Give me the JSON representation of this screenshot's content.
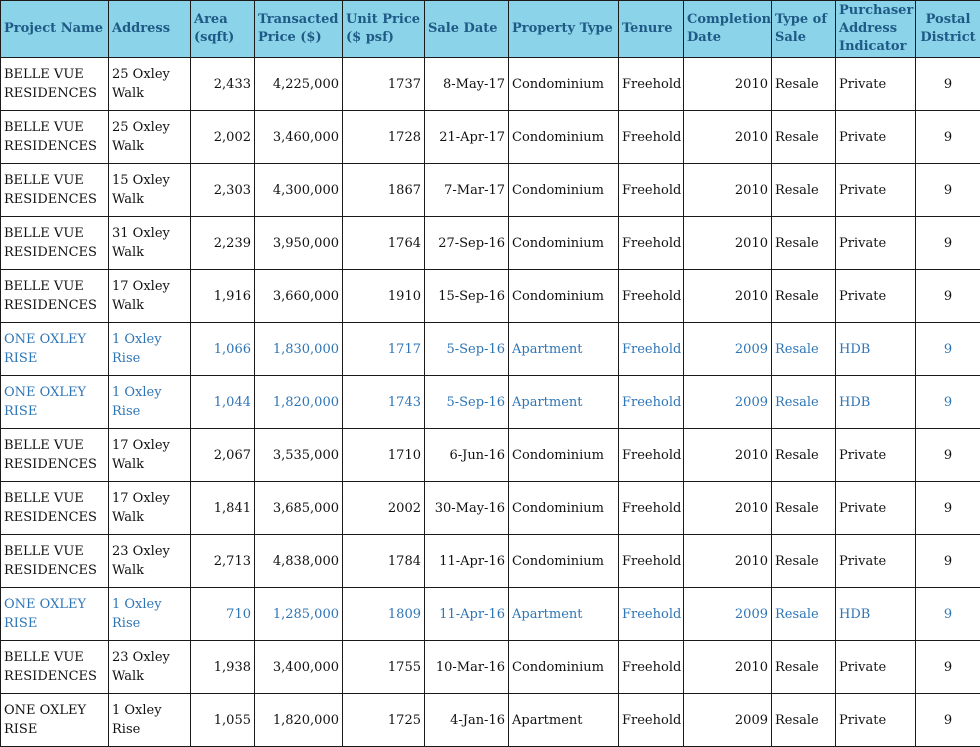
{
  "colors": {
    "header_bg": "#8bd3e8",
    "header_text": "#1f5a86",
    "highlight_text": "#2e75b6",
    "border": "#1a1a1a"
  },
  "headers": [
    "Project Name",
    "Address",
    "Area (sqft)",
    "Transacted Price ($)",
    "Unit Price ($ psf)",
    "Sale Date",
    "Property Type",
    "Tenure",
    "Completion Date",
    "Type of Sale",
    "Purchaser Address Indicator",
    "Postal District"
  ],
  "rows": [
    {
      "project": "BELLE VUE RESIDENCES",
      "address": "25 Oxley Walk",
      "area": "2,433",
      "price": "4,225,000",
      "unit_price": "1737",
      "sale_date": "8-May-17",
      "property_type": "Condominium",
      "tenure": "Freehold",
      "completion": "2010",
      "sale_type": "Resale",
      "purchaser": "Private",
      "district": "9",
      "highlight": false
    },
    {
      "project": "BELLE VUE RESIDENCES",
      "address": "25 Oxley Walk",
      "area": "2,002",
      "price": "3,460,000",
      "unit_price": "1728",
      "sale_date": "21-Apr-17",
      "property_type": "Condominium",
      "tenure": "Freehold",
      "completion": "2010",
      "sale_type": "Resale",
      "purchaser": "Private",
      "district": "9",
      "highlight": false
    },
    {
      "project": "BELLE VUE RESIDENCES",
      "address": "15 Oxley Walk",
      "area": "2,303",
      "price": "4,300,000",
      "unit_price": "1867",
      "sale_date": "7-Mar-17",
      "property_type": "Condominium",
      "tenure": "Freehold",
      "completion": "2010",
      "sale_type": "Resale",
      "purchaser": "Private",
      "district": "9",
      "highlight": false
    },
    {
      "project": "BELLE VUE RESIDENCES",
      "address": "31 Oxley Walk",
      "area": "2,239",
      "price": "3,950,000",
      "unit_price": "1764",
      "sale_date": "27-Sep-16",
      "property_type": "Condominium",
      "tenure": "Freehold",
      "completion": "2010",
      "sale_type": "Resale",
      "purchaser": "Private",
      "district": "9",
      "highlight": false
    },
    {
      "project": "BELLE VUE RESIDENCES",
      "address": "17 Oxley Walk",
      "area": "1,916",
      "price": "3,660,000",
      "unit_price": "1910",
      "sale_date": "15-Sep-16",
      "property_type": "Condominium",
      "tenure": "Freehold",
      "completion": "2010",
      "sale_type": "Resale",
      "purchaser": "Private",
      "district": "9",
      "highlight": false
    },
    {
      "project": "ONE OXLEY RISE",
      "address": "1 Oxley Rise",
      "area": "1,066",
      "price": "1,830,000",
      "unit_price": "1717",
      "sale_date": "5-Sep-16",
      "property_type": "Apartment",
      "tenure": "Freehold",
      "completion": "2009",
      "sale_type": "Resale",
      "purchaser": "HDB",
      "district": "9",
      "highlight": true
    },
    {
      "project": "ONE OXLEY RISE",
      "address": "1 Oxley Rise",
      "area": "1,044",
      "price": "1,820,000",
      "unit_price": "1743",
      "sale_date": "5-Sep-16",
      "property_type": "Apartment",
      "tenure": "Freehold",
      "completion": "2009",
      "sale_type": "Resale",
      "purchaser": "HDB",
      "district": "9",
      "highlight": true
    },
    {
      "project": "BELLE VUE RESIDENCES",
      "address": "17 Oxley Walk",
      "area": "2,067",
      "price": "3,535,000",
      "unit_price": "1710",
      "sale_date": "6-Jun-16",
      "property_type": "Condominium",
      "tenure": "Freehold",
      "completion": "2010",
      "sale_type": "Resale",
      "purchaser": "Private",
      "district": "9",
      "highlight": false
    },
    {
      "project": "BELLE VUE RESIDENCES",
      "address": "17 Oxley Walk",
      "area": "1,841",
      "price": "3,685,000",
      "unit_price": "2002",
      "sale_date": "30-May-16",
      "property_type": "Condominium",
      "tenure": "Freehold",
      "completion": "2010",
      "sale_type": "Resale",
      "purchaser": "Private",
      "district": "9",
      "highlight": false
    },
    {
      "project": "BELLE VUE RESIDENCES",
      "address": "23 Oxley Walk",
      "area": "2,713",
      "price": "4,838,000",
      "unit_price": "1784",
      "sale_date": "11-Apr-16",
      "property_type": "Condominium",
      "tenure": "Freehold",
      "completion": "2010",
      "sale_type": "Resale",
      "purchaser": "Private",
      "district": "9",
      "highlight": false
    },
    {
      "project": "ONE OXLEY RISE",
      "address": "1 Oxley Rise",
      "area": "710",
      "price": "1,285,000",
      "unit_price": "1809",
      "sale_date": "11-Apr-16",
      "property_type": "Apartment",
      "tenure": "Freehold",
      "completion": "2009",
      "sale_type": "Resale",
      "purchaser": "HDB",
      "district": "9",
      "highlight": true
    },
    {
      "project": "BELLE VUE RESIDENCES",
      "address": "23 Oxley Walk",
      "area": "1,938",
      "price": "3,400,000",
      "unit_price": "1755",
      "sale_date": "10-Mar-16",
      "property_type": "Condominium",
      "tenure": "Freehold",
      "completion": "2010",
      "sale_type": "Resale",
      "purchaser": "Private",
      "district": "9",
      "highlight": false
    },
    {
      "project": "ONE OXLEY RISE",
      "address": "1 Oxley Rise",
      "area": "1,055",
      "price": "1,820,000",
      "unit_price": "1725",
      "sale_date": "4-Jan-16",
      "property_type": "Apartment",
      "tenure": "Freehold",
      "completion": "2009",
      "sale_type": "Resale",
      "purchaser": "Private",
      "district": "9",
      "highlight": false
    }
  ]
}
